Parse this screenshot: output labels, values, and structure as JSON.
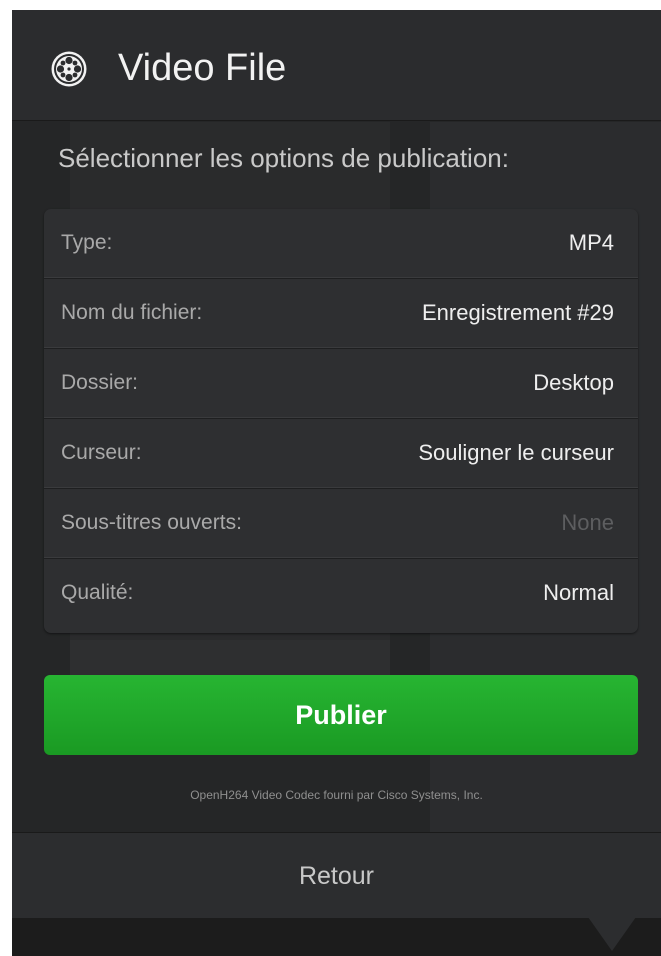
{
  "dialog": {
    "title": "Video File",
    "icon": "film-reel-icon"
  },
  "subtitle": "Sélectionner les options de publication:",
  "options": [
    {
      "label": "Type:",
      "value": "MP4"
    },
    {
      "label": "Nom du fichier:",
      "value": "Enregistrement #29"
    },
    {
      "label": "Dossier:",
      "value": "Desktop"
    },
    {
      "label": "Curseur:",
      "value": "Souligner le curseur"
    },
    {
      "label": "Sous-titres ouverts:",
      "value": "None"
    },
    {
      "label": "Qualité:",
      "value": "Normal"
    }
  ],
  "publish_label": "Publier",
  "codec_note": "OpenH264 Video Codec fourni par Cisco Systems, Inc.",
  "back_label": "Retour",
  "colors": {
    "panel_bg": "#252627",
    "accent_green": "#1fa82a",
    "muted_value": "#5d5e60"
  }
}
